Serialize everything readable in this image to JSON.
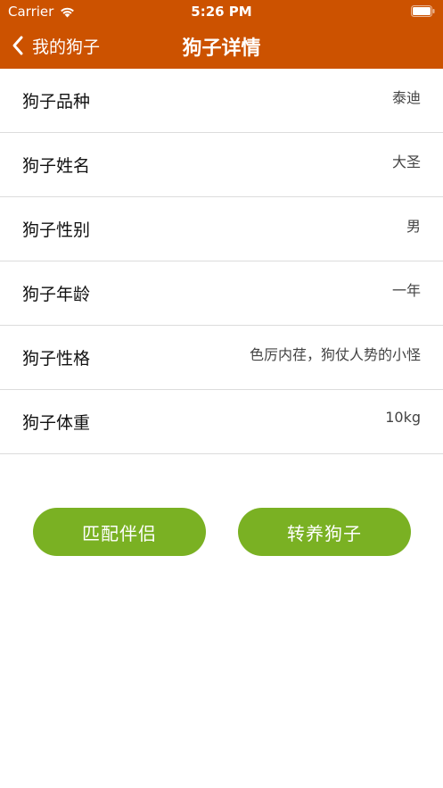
{
  "status_bar": {
    "carrier": "Carrier",
    "time": "5:26 PM"
  },
  "nav": {
    "back_label": "我的狗子",
    "title": "狗子详情",
    "color": "#cc5200"
  },
  "details": [
    {
      "label": "狗子品种",
      "value": "泰迪"
    },
    {
      "label": "狗子姓名",
      "value": "大圣"
    },
    {
      "label": "狗子性别",
      "value": "男"
    },
    {
      "label": "狗子年龄",
      "value": "一年"
    },
    {
      "label": "狗子性格",
      "value": "色厉内荏，狗仗人势的小怪"
    },
    {
      "label": "狗子体重",
      "value": "10kg"
    }
  ],
  "buttons": {
    "match_label": "匹配伴侣",
    "transfer_label": "转养狗子",
    "color": "#7ab123"
  }
}
